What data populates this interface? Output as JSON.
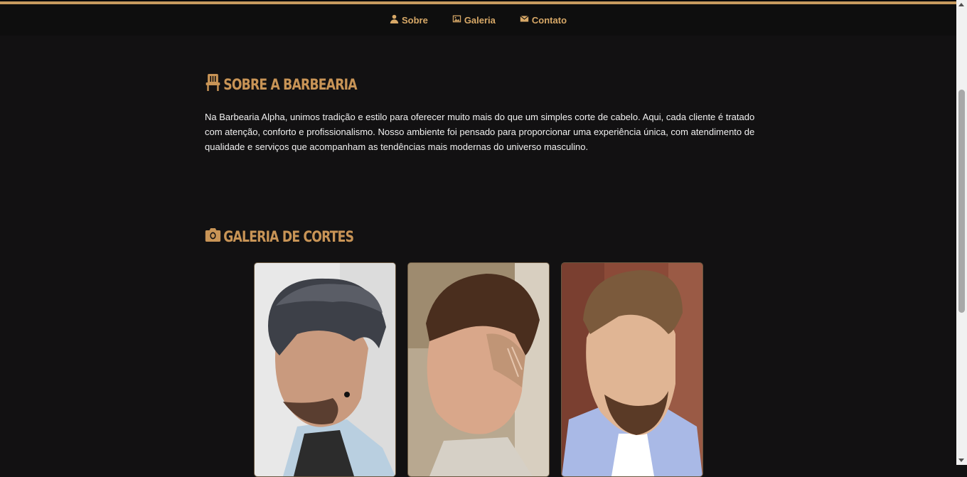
{
  "nav": {
    "items": [
      {
        "label": "Sobre",
        "icon": "user-icon"
      },
      {
        "label": "Galeria",
        "icon": "image-icon"
      },
      {
        "label": "Contato",
        "icon": "envelope-icon"
      }
    ]
  },
  "about": {
    "icon": "barber-chair-icon",
    "title": "SOBRE A BARBEARIA",
    "text": "Na Barbearia Alpha, unimos tradição e estilo para oferecer muito mais do que um simples corte de cabelo. Aqui, cada cliente é tratado com atenção, conforto e profissionalismo. Nosso ambiente foi pensado para proporcionar uma experiência única, com atendimento de qualidade e serviços que acompanham as tendências mais modernas do universo masculino."
  },
  "gallery": {
    "icon": "camera-icon",
    "title": "GALERIA DE CORTES",
    "images": [
      "haircut-photo-1",
      "haircut-photo-2",
      "haircut-photo-3"
    ]
  },
  "colors": {
    "accent": "#c89456",
    "background": "#121112",
    "navbar": "#0e0e0e",
    "text": "#f1f1f1"
  }
}
